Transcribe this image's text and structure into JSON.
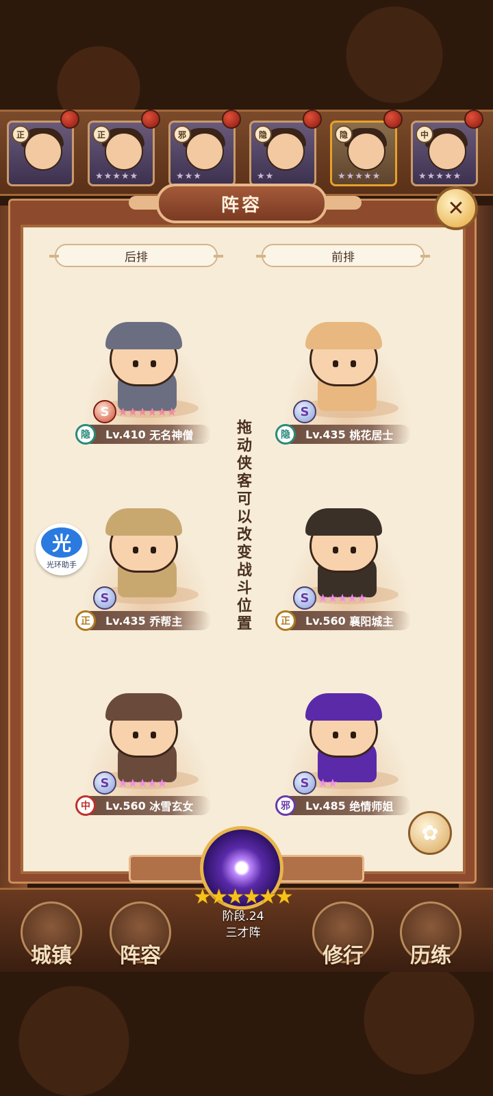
{
  "hero_strip": [
    {
      "faction": "正",
      "stars": ""
    },
    {
      "faction": "正",
      "stars": "★★★★★"
    },
    {
      "faction": "邪",
      "stars": "★★★"
    },
    {
      "faction": "隐",
      "stars": "★★"
    },
    {
      "faction": "隐",
      "stars": "★★★★★"
    },
    {
      "faction": "中",
      "stars": "★★★★★"
    }
  ],
  "panel": {
    "title": "阵容",
    "back_row_label": "后排",
    "front_row_label": "前排",
    "hint": "拖动侠客可以改变战斗位置"
  },
  "heroes": [
    {
      "faction": "隐",
      "level": "Lv.410",
      "name": "无名神僧",
      "stars": 6,
      "star_color": "#f08aa0",
      "symbol": "S",
      "hat_color": "#6a6e80"
    },
    {
      "faction": "隐",
      "level": "Lv.435",
      "name": "桃花居士",
      "stars": 0,
      "star_color": "#f08aa0",
      "symbol": "S",
      "hat_color": "#e8b880"
    },
    {
      "faction": "正",
      "level": "Lv.435",
      "name": "乔帮主",
      "stars": 0,
      "star_color": "#f08aa0",
      "symbol": "S",
      "hat_color": "#c9a870"
    },
    {
      "faction": "正",
      "level": "Lv.560",
      "name": "襄阳城主",
      "stars": 5,
      "star_color": "#f090e0",
      "symbol": "S",
      "hat_color": "#3a3028"
    },
    {
      "faction": "中",
      "level": "Lv.560",
      "name": "冰雪玄女",
      "stars": 5,
      "star_color": "#f090e0",
      "symbol": "S",
      "hat_color": "#6a4a3a"
    },
    {
      "faction": "邪",
      "level": "Lv.485",
      "name": "绝情师姐",
      "stars": 2,
      "star_color": "#f090e0",
      "symbol": "S",
      "hat_color": "#5a2aa8"
    }
  ],
  "helper": {
    "icon": "光",
    "label": "光环助手"
  },
  "stage": {
    "stars": "★★★★★★",
    "stage_label": "阶段.24",
    "formation_name": "三才阵"
  },
  "bottom_nav": [
    {
      "label": "城镇"
    },
    {
      "label": "阵容"
    },
    {
      "label": "修行"
    },
    {
      "label": "历练"
    }
  ],
  "colors": {
    "panel_bg": "#f6ecd8",
    "frame": "#8e4a2c",
    "accent_gold": "#e8b54a"
  }
}
